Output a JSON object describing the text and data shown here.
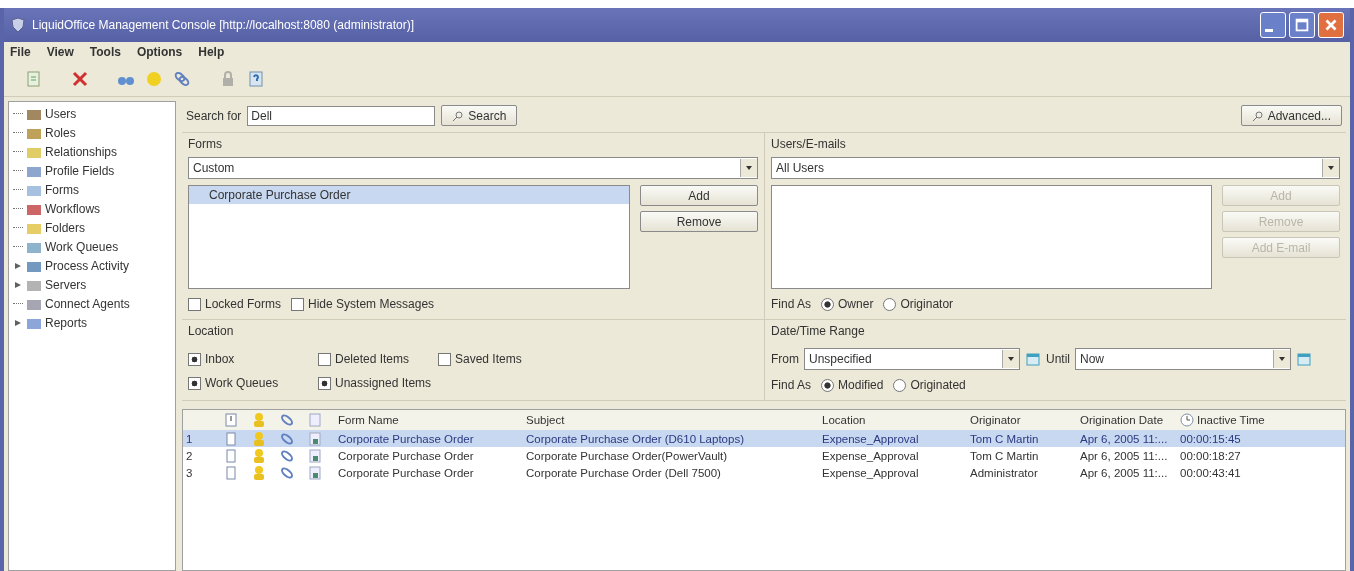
{
  "window": {
    "title": "LiquidOffice Management Console [http://localhost:8080 (administrator)]"
  },
  "menu": [
    "File",
    "View",
    "Tools",
    "Options",
    "Help"
  ],
  "tree": [
    {
      "label": "Users",
      "kind": "leaf"
    },
    {
      "label": "Roles",
      "kind": "leaf"
    },
    {
      "label": "Relationships",
      "kind": "leaf"
    },
    {
      "label": "Profile Fields",
      "kind": "leaf"
    },
    {
      "label": "Forms",
      "kind": "leaf"
    },
    {
      "label": "Workflows",
      "kind": "leaf"
    },
    {
      "label": "Folders",
      "kind": "leaf"
    },
    {
      "label": "Work Queues",
      "kind": "leaf"
    },
    {
      "label": "Process Activity",
      "kind": "collapsed"
    },
    {
      "label": "Servers",
      "kind": "collapsed"
    },
    {
      "label": "Connect Agents",
      "kind": "leaf"
    },
    {
      "label": "Reports",
      "kind": "collapsed"
    }
  ],
  "search": {
    "label": "Search for",
    "value": "Dell",
    "button": "Search",
    "advanced": "Advanced..."
  },
  "forms": {
    "title": "Forms",
    "dropdown": "Custom",
    "items": [
      {
        "label": "Corporate Purchase Order",
        "selected": true
      }
    ],
    "buttons": [
      {
        "label": "Add",
        "disabled": false
      },
      {
        "label": "Remove",
        "disabled": false
      }
    ],
    "checkboxes": [
      {
        "label": "Locked Forms",
        "checked": false
      },
      {
        "label": "Hide System Messages",
        "checked": false
      }
    ]
  },
  "users": {
    "title": "Users/E-mails",
    "dropdown": "All Users",
    "buttons": [
      {
        "label": "Add",
        "disabled": true
      },
      {
        "label": "Remove",
        "disabled": true
      },
      {
        "label": "Add E-mail",
        "disabled": true
      }
    ],
    "find_as": "Find As",
    "radios": [
      {
        "label": "Owner",
        "selected": true
      },
      {
        "label": "Originator",
        "selected": false
      }
    ]
  },
  "location": {
    "title": "Location",
    "checkboxes": [
      {
        "label": "Inbox",
        "checked": true
      },
      {
        "label": "Deleted Items",
        "checked": false
      },
      {
        "label": "Saved Items",
        "checked": false
      },
      {
        "label": "Work Queues",
        "checked": true
      },
      {
        "label": "Unassigned Items",
        "checked": true
      }
    ]
  },
  "date_range": {
    "title": "Date/Time Range",
    "from_label": "From",
    "from": "Unspecified",
    "until_label": "Until",
    "until": "Now",
    "find_as": "Find As",
    "radios": [
      {
        "label": "Modified",
        "selected": true
      },
      {
        "label": "Originated",
        "selected": false
      }
    ]
  },
  "table": {
    "columns": [
      "Form Name",
      "Subject",
      "Location",
      "Originator",
      "Origination Date",
      "Inactive Time"
    ],
    "rows": [
      {
        "number": "1",
        "selected": true,
        "cells": [
          "Corporate Purchase Order",
          "Corporate Purchase Order (D610 Laptops)",
          "Expense_Approval",
          "Tom C Martin",
          "Apr 6, 2005 11:...",
          "00:00:15:45"
        ]
      },
      {
        "number": "2",
        "selected": false,
        "cells": [
          "Corporate Purchase Order",
          "Corporate Purchase Order(PowerVault)",
          "Expense_Approval",
          "Tom C Martin",
          "Apr 6, 2005 11:...",
          "00:00:18:27"
        ]
      },
      {
        "number": "3",
        "selected": false,
        "cells": [
          "Corporate Purchase Order",
          "Corporate Purchase Order (Dell 7500)",
          "Expense_Approval",
          "Administrator",
          "Apr 6, 2005 11:...",
          "00:00:43:41"
        ]
      }
    ]
  }
}
